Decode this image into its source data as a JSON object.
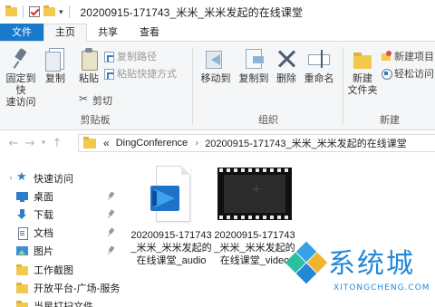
{
  "window": {
    "title": "20200915-171743_米米_米米发起的在线课堂"
  },
  "ribbon": {
    "tabs": [
      {
        "label": "文件"
      },
      {
        "label": "主页"
      },
      {
        "label": "共享"
      },
      {
        "label": "查看"
      }
    ],
    "clipboard": {
      "pin_label_1": "固定到快",
      "pin_label_2": "速访问",
      "copy_label": "复制",
      "paste_label": "粘贴",
      "copy_path_label": "复制路径",
      "paste_shortcut_label": "粘贴快捷方式",
      "cut_label": "剪切",
      "group_label": "剪贴板"
    },
    "organize": {
      "move_to_label": "移动到",
      "copy_to_label": "复制到",
      "delete_label": "删除",
      "rename_label": "重命名",
      "group_label": "组织"
    },
    "new": {
      "new_folder_label_1": "新建",
      "new_folder_label_2": "文件夹",
      "new_item_label": "新建项目",
      "easy_access_label": "轻松访问",
      "group_label": "新建"
    }
  },
  "address_bar": {
    "overflow": "«",
    "crumbs": [
      "DingConference",
      "20200915-171743_米米_米米发起的在线课堂"
    ]
  },
  "sidebar": {
    "items": [
      {
        "label": "快速访问",
        "icon": "star-icon"
      },
      {
        "label": "桌面",
        "icon": "desktop-icon"
      },
      {
        "label": "下载",
        "icon": "download-icon"
      },
      {
        "label": "文档",
        "icon": "documents-icon"
      },
      {
        "label": "图片",
        "icon": "pictures-icon"
      },
      {
        "label": "工作截图",
        "icon": "folder-icon"
      },
      {
        "label": "开放平台-广场-服务",
        "icon": "folder-icon"
      },
      {
        "label": "当星打扫文件",
        "icon": "folder-icon"
      }
    ]
  },
  "files": [
    {
      "name": "20200915-171743_米米_米米发起的在线课堂_audio",
      "icon": "audio-file-icon"
    },
    {
      "name": "20200915-171743_米米_米米发起的在线课堂_video",
      "icon": "video-file-icon"
    }
  ],
  "watermark": {
    "text": "系统城",
    "url": "XITONGCHENG.COM"
  },
  "colors": {
    "accent": "#1979ca",
    "folder": "#f2c94c"
  }
}
